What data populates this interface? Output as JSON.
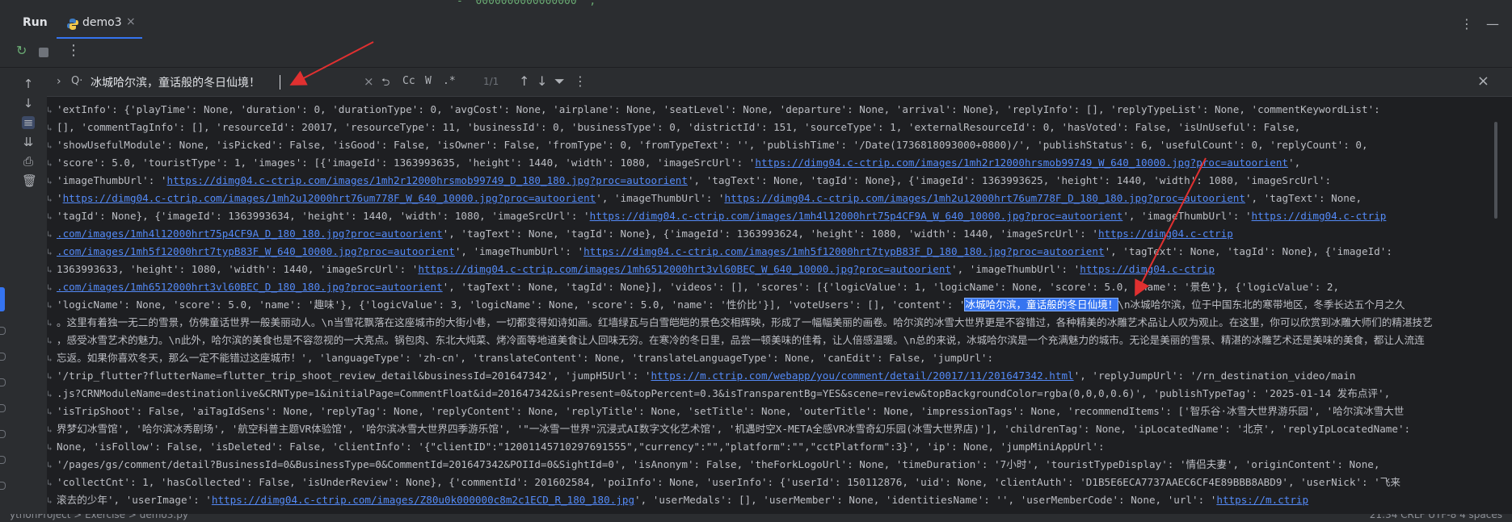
{
  "top_code": "-  \"0000000000000000\" ,",
  "toolbar": {
    "run_label": "Run",
    "tab_title": "demo3",
    "tab_close": "×",
    "more": "⋮",
    "minimize": "—"
  },
  "actions": {
    "rerun_icon": "↻",
    "stop_icon": "stop",
    "more_icon": "⋮"
  },
  "find": {
    "expand_icon": "›",
    "search_icon": "Q·",
    "query": "冰城哈尔滨，童话般的冬日仙境！",
    "clear_icon": "×",
    "options": [
      "⮌",
      "Cc",
      "W",
      ".*"
    ],
    "count": "1/1",
    "close_icon": "×"
  },
  "highlight": "冰城哈尔滨，童话般的冬日仙境！",
  "console_lines": [
    [
      {
        "t": "'extInfo': {'playTime': None, 'duration': 0, 'durationType': 0, 'avgCost': None, 'airplane': None, 'seatLevel': None, 'departure': None, 'arrival': None}, 'replyInfo': [], 'replyTypeList': None, 'commentKeywordList':"
      }
    ],
    [
      {
        "t": "[], 'commentTagInfo': [], 'resourceId': 20017, 'resourceType': 11, 'businessId': 0, 'businessType': 0, 'districtId': 151, 'sourceType': 1, 'externalResourceId': 0, 'hasVoted': False, 'isUnUseful': False,"
      }
    ],
    [
      {
        "t": "'showUsefulModule': None, 'isPicked': False, 'isGood': False, 'isOwner': False, 'fromType': 0, 'fromTypeText': '', 'publishTime': '/Date(1736818093000+0800)/', 'publishStatus': 6, 'usefulCount': 0, 'replyCount': 0,"
      }
    ],
    [
      {
        "t": "'score': 5.0, 'touristType': 1, 'images': [{'imageId': 1363993635, 'height': 1440, 'width': 1080, 'imageSrcUrl': '"
      },
      {
        "t": "https://dimg04.c-ctrip.com/images/1mh2r12000hrsmob99749_W_640_10000.jpg?proc=autoorient",
        "k": "link"
      },
      {
        "t": "',"
      }
    ],
    [
      {
        "t": "'imageThumbUrl': '"
      },
      {
        "t": "https://dimg04.c-ctrip.com/images/1mh2r12000hrsmob99749_D_180_180.jpg?proc=autoorient",
        "k": "link"
      },
      {
        "t": "', 'tagText': None, 'tagId': None}, {'imageId': 1363993625, 'height': 1440, 'width': 1080, 'imageSrcUrl':"
      }
    ],
    [
      {
        "t": "'"
      },
      {
        "t": "https://dimg04.c-ctrip.com/images/1mh2u12000hrt76um778F_W_640_10000.jpg?proc=autoorient",
        "k": "link"
      },
      {
        "t": "', 'imageThumbUrl': '"
      },
      {
        "t": "https://dimg04.c-ctrip.com/images/1mh2u12000hrt76um778F_D_180_180.jpg?proc=autoorient",
        "k": "link"
      },
      {
        "t": "', 'tagText': None,"
      }
    ],
    [
      {
        "t": "'tagId': None}, {'imageId': 1363993634, 'height': 1440, 'width': 1080, 'imageSrcUrl': '"
      },
      {
        "t": "https://dimg04.c-ctrip.com/images/1mh4l12000hrt75p4CF9A_W_640_10000.jpg?proc=autoorient",
        "k": "link"
      },
      {
        "t": "', 'imageThumbUrl': '"
      },
      {
        "t": "https://dimg04.c-ctrip",
        "k": "link"
      }
    ],
    [
      {
        "t": ".com/images/1mh4l12000hrt75p4CF9A_D_180_180.jpg?proc=autoorient",
        "k": "link"
      },
      {
        "t": "', 'tagText': None, 'tagId': None}, {'imageId': 1363993624, 'height': 1080, 'width': 1440, 'imageSrcUrl': '"
      },
      {
        "t": "https://dimg04.c-ctrip",
        "k": "link"
      }
    ],
    [
      {
        "t": ".com/images/1mh5f12000hrt7typB83F_W_640_10000.jpg?proc=autoorient",
        "k": "link"
      },
      {
        "t": "', 'imageThumbUrl': '"
      },
      {
        "t": "https://dimg04.c-ctrip.com/images/1mh5f12000hrt7typB83F_D_180_180.jpg?proc=autoorient",
        "k": "link"
      },
      {
        "t": "', 'tagText': None, 'tagId': None}, {'imageId':"
      }
    ],
    [
      {
        "t": "1363993633, 'height': 1080, 'width': 1440, 'imageSrcUrl': '"
      },
      {
        "t": "https://dimg04.c-ctrip.com/images/1mh6512000hrt3vl60BEC_W_640_10000.jpg?proc=autoorient",
        "k": "link"
      },
      {
        "t": "', 'imageThumbUrl': '"
      },
      {
        "t": "https://dimg04.c-ctrip",
        "k": "link"
      }
    ],
    [
      {
        "t": ".com/images/1mh6512000hrt3vl60BEC_D_180_180.jpg?proc=autoorient",
        "k": "link"
      },
      {
        "t": "', 'tagText': None, 'tagId': None}], 'videos': [], 'scores': [{'logicValue': 1, 'logicName': None, 'score': 5.0, 'name': '景色'}, {'logicValue': 2,"
      }
    ],
    [
      {
        "t": "'logicName': None, 'score': 5.0, 'name': '趣味'}, {'logicValue': 3, 'logicName': None, 'score': 5.0, 'name': '性价比'}], 'voteUsers': [], 'content': '"
      },
      {
        "t": "冰城哈尔滨，童话般的冬日仙境！",
        "k": "hl"
      },
      {
        "t": "\\n冰城哈尔滨，位于中国东北的寒带地区，冬季长达五个月之久"
      }
    ],
    [
      {
        "t": "。这里有着独一无二的雪景，仿佛童话世界一般美丽动人。\\n当雪花飘落在这座城市的大街小巷，一切都变得如诗如画。红墙绿瓦与白雪皑皑的景色交相辉映，形成了一幅幅美丽的画卷。哈尔滨的冰雪大世界更是不容错过，各种精美的冰雕艺术品让人叹为观止。在这里，你可以欣赏到冰雕大师们的精湛技艺"
      }
    ],
    [
      {
        "t": "，感受冰雪艺术的魅力。\\n此外，哈尔滨的美食也是不容忽视的一大亮点。锅包肉、东北大炖菜、烤冷面等地道美食让人回味无穷。在寒冷的冬日里，品尝一顿美味的佳肴，让人倍感温暖。\\n总的来说，冰城哈尔滨是一个充满魅力的城市。无论是美丽的雪景、精湛的冰雕艺术还是美味的美食，都让人流连"
      }
    ],
    [
      {
        "t": "忘返。如果你喜欢冬天，那么一定不能错过这座城市！', 'languageType': 'zh-cn', 'translateContent': None, 'translateLanguageType': None, 'canEdit': False, 'jumpUrl':"
      }
    ],
    [
      {
        "t": "'/trip_flutter?flutterName=flutter_trip_shoot_review_detail&businessId=201647342', 'jumpH5Url': '"
      },
      {
        "t": "https://m.ctrip.com/webapp/you/comment/detail/20017/11/201647342.html",
        "k": "link"
      },
      {
        "t": "', 'replyJumpUrl': '/rn_destination_video/main"
      }
    ],
    [
      {
        "t": ".js?CRNModuleName=destinationlive&CRNType=1&initialPage=CommentFloat&id=201647342&isPresent=0&topPercent=0.3&isTransparentBg=YES&scene=review&topBackgroundColor=rgba(0,0,0,0.6)', 'publishTypeTag': '2025-01-14 发布点评',"
      }
    ],
    [
      {
        "t": "'isTripShoot': False, 'aiTagIdSens': None, 'replyTag': None, 'replyContent': None, 'replyTitle': None, 'setTitle': None, 'outerTitle': None, 'impressionTags': None, 'recommendItems': ['智乐谷·冰雪大世界游乐园', '哈尔滨冰雪大世"
      }
    ],
    [
      {
        "t": "界梦幻冰雪馆', '哈尔滨冰秀剧场', '航空科普主题VR体验馆', '哈尔滨冰雪大世界四季游乐馆', '\"一冰雪一世界\"沉浸式AI数字文化艺术馆', '机遇时空X-META全感VR冰雪奇幻乐园(冰雪大世界店)'], 'childrenTag': None, 'ipLocatedName': '北京', 'replyIpLocatedName':"
      }
    ],
    [
      {
        "t": "None, 'isFollow': False, 'isDeleted': False, 'clientInfo': '{\"clientID\":\"12001145710297691555\",\"currency\":\"\",\"platform\":\"\",\"cctPlatform\":3}', 'ip': None, 'jumpMiniAppUrl':"
      }
    ],
    [
      {
        "t": "'/pages/gs/comment/detail?BusinessId=0&BusinessType=0&CommentId=201647342&POIId=0&SightId=0', 'isAnonym': False, 'theForkLogoUrl': None, 'timeDuration': '7小时', 'touristTypeDisplay': '情侣夫妻', 'originContent': None,"
      }
    ],
    [
      {
        "t": "'collectCnt': 1, 'hasCollected': False, 'isUnderReview': None}, {'commentId': 201602584, 'poiInfo': None, 'userInfo': {'userId': 150112876, 'uid': None, 'clientAuth': 'D1B5E6ECA7737AAEC6CF4E89BBB8ABD9', 'userNick': '飞来"
      }
    ],
    [
      {
        "t": "滚去的少年', 'userImage': '"
      },
      {
        "t": "https://dimg04.c-ctrip.com/images/Z80u0k000000c8m2c1ECD_R_180_180.jpg",
        "k": "link"
      },
      {
        "t": "', 'userMedals': [], 'userMember': None, 'identitiesName': '', 'userMemberCode': None, 'url': '"
      },
      {
        "t": "https://m.ctrip",
        "k": "link"
      }
    ]
  ],
  "status": {
    "left": "ythonProject  >  Exercise  >  demo3.py",
    "right": "21:34   CRLF   UTF-8   4 spaces"
  }
}
